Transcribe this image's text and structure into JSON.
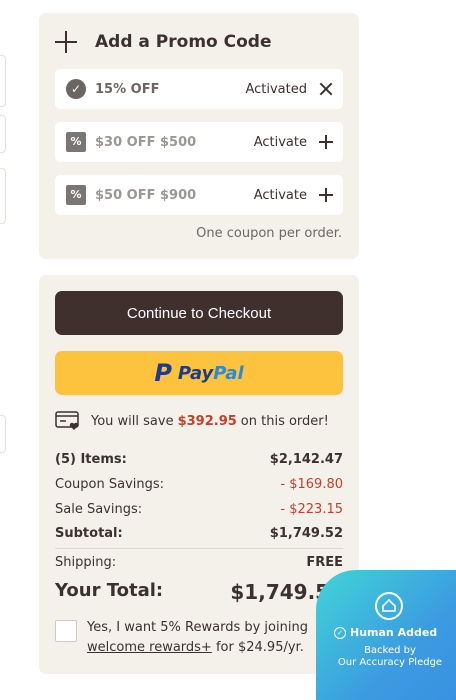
{
  "promo": {
    "title": "Add a Promo Code",
    "coupons": [
      {
        "name": "15% OFF",
        "action": "Activated",
        "state": "active",
        "icon": "check-circle-icon"
      },
      {
        "name": "$30 OFF $500",
        "action": "Activate",
        "state": "inactive",
        "icon": "percent-tag-icon"
      },
      {
        "name": "$50 OFF $900",
        "action": "Activate",
        "state": "inactive",
        "icon": "percent-tag-icon"
      }
    ],
    "note": "One coupon per order."
  },
  "summary": {
    "checkout_label": "Continue to Checkout",
    "paypal": {
      "pay": "Pay",
      "pal": "Pal"
    },
    "save_prefix": "You will save",
    "save_amount": "$392.95",
    "save_suffix": "on this order!",
    "items_label": "(5) Items:",
    "items_value": "$2,142.47",
    "coupon_label": "Coupon Savings:",
    "coupon_value": "- $169.80",
    "sale_label": "Sale Savings:",
    "sale_value": "- $223.15",
    "subtotal_label": "Subtotal:",
    "subtotal_value": "$1,749.52",
    "shipping_label": "Shipping:",
    "shipping_value": "FREE",
    "total_label": "Your Total:",
    "total_value": "$1,749.52",
    "rewards_text_1": "Yes, I want 5% Rewards by joining",
    "rewards_link": "welcome rewards+",
    "rewards_text_2": "for $24.95/yr."
  },
  "pledge": {
    "title": "Human Added",
    "line1": "Backed by",
    "line2": "Our Accuracy Pledge"
  },
  "colors": {
    "panel_bg": "#f4f1ea",
    "checkout_bg": "#3f302e",
    "paypal_bg": "#fdc23e",
    "savings_red": "#c43f2a"
  }
}
